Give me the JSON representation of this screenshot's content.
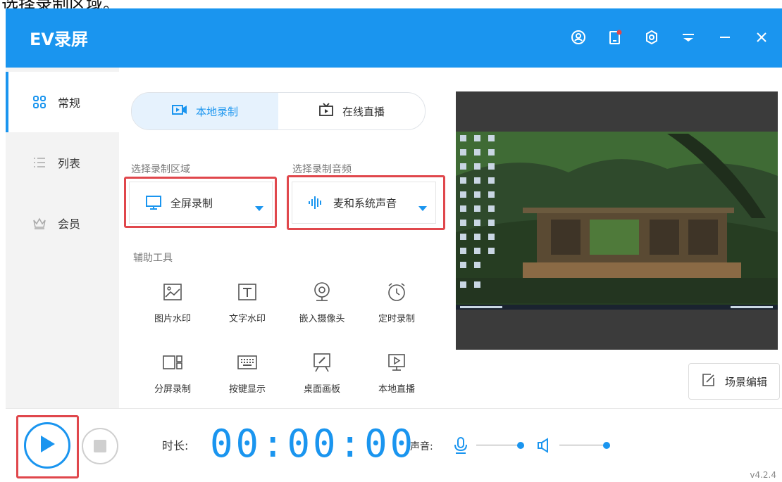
{
  "top_caption": "选择录制区域。",
  "app": {
    "title": "EV录屏"
  },
  "titlebar_icons": [
    "user-icon",
    "phone-notify-icon",
    "settings-icon",
    "menu-icon",
    "minimize-icon",
    "close-icon"
  ],
  "sidebar": {
    "items": [
      {
        "label": "常规",
        "icon": "grid-icon",
        "active": true
      },
      {
        "label": "列表",
        "icon": "list-icon",
        "active": false
      },
      {
        "label": "会员",
        "icon": "crown-icon",
        "active": false
      }
    ]
  },
  "tabs": [
    {
      "label": "本地录制",
      "icon": "record-icon",
      "active": true
    },
    {
      "label": "在线直播",
      "icon": "tv-icon",
      "active": false
    }
  ],
  "record_area": {
    "label": "选择录制区域",
    "value": "全屏录制"
  },
  "record_audio": {
    "label": "选择录制音频",
    "value": "麦和系统声音"
  },
  "tools": {
    "label": "辅助工具",
    "items": [
      {
        "label": "图片水印",
        "icon": "image-icon"
      },
      {
        "label": "文字水印",
        "icon": "text-icon"
      },
      {
        "label": "嵌入摄像头",
        "icon": "webcam-icon"
      },
      {
        "label": "定时录制",
        "icon": "alarm-icon"
      },
      {
        "label": "分屏录制",
        "icon": "split-screen-icon"
      },
      {
        "label": "按键显示",
        "icon": "keyboard-icon"
      },
      {
        "label": "桌面画板",
        "icon": "whiteboard-icon"
      },
      {
        "label": "本地直播",
        "icon": "monitor-play-icon"
      }
    ]
  },
  "scene_edit": {
    "label": "场景编辑"
  },
  "bottom": {
    "duration_label": "时长:",
    "time": "00:00:00",
    "volume_label": "声音:",
    "mic_level": 1.0,
    "speaker_level": 1.0
  },
  "version": "v4.2.4",
  "colors": {
    "accent": "#1a95ef",
    "highlight": "#e0474c",
    "sidebar_bg": "#f3f3f3"
  }
}
